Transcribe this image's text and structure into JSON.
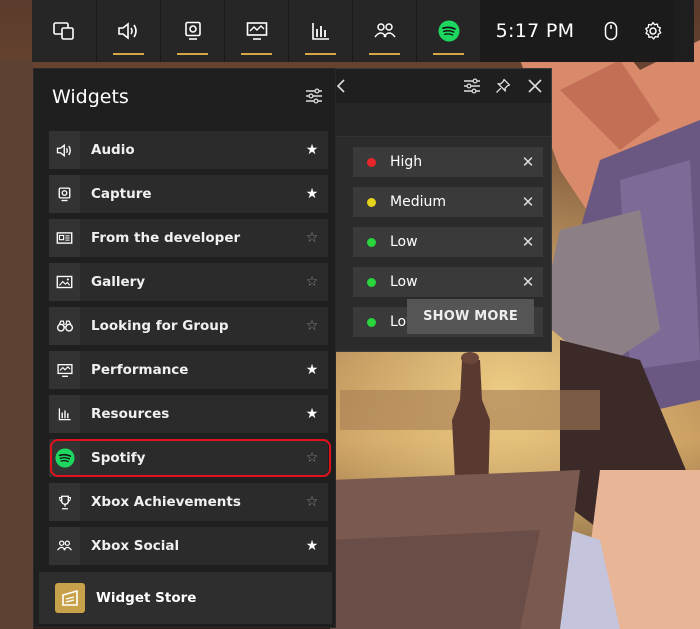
{
  "topbar": {
    "time": "5:17 PM",
    "items": [
      {
        "name": "home-icon"
      },
      {
        "name": "audio-icon"
      },
      {
        "name": "capture-icon"
      },
      {
        "name": "performance-icon"
      },
      {
        "name": "resources-icon"
      },
      {
        "name": "social-icon"
      },
      {
        "name": "spotify-icon"
      }
    ]
  },
  "resources": {
    "rows": [
      {
        "label": "High",
        "dot": "#e8262a"
      },
      {
        "label": "Medium",
        "dot": "#e6d31b"
      },
      {
        "label": "Low",
        "dot": "#2bd43a"
      },
      {
        "label": "Low",
        "dot": "#2bd43a"
      },
      {
        "label": "Low",
        "dot": "#2bd43a"
      }
    ],
    "show_more": "SHOW MORE",
    "close_glyph": "✕"
  },
  "widgets": {
    "title": "Widgets",
    "items": [
      {
        "label": "Audio",
        "starred": true
      },
      {
        "label": "Capture",
        "starred": true
      },
      {
        "label": "From the developer",
        "starred": false
      },
      {
        "label": "Gallery",
        "starred": false
      },
      {
        "label": "Looking for Group",
        "starred": false
      },
      {
        "label": "Performance",
        "starred": true
      },
      {
        "label": "Resources",
        "starred": true
      },
      {
        "label": "Spotify",
        "starred": false
      },
      {
        "label": "Xbox Achievements",
        "starred": false
      },
      {
        "label": "Xbox Social",
        "starred": true
      }
    ],
    "store_label": "Widget Store",
    "star_on": "★",
    "star_off": "☆"
  },
  "colors": {
    "accent": "#d6a64a",
    "highlight": "#e0121c",
    "spotify": "#1ed760"
  }
}
